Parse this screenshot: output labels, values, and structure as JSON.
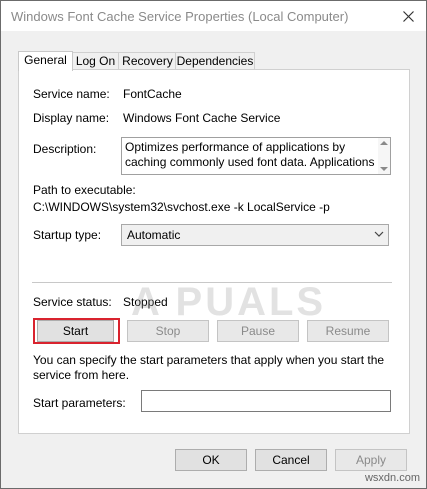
{
  "window": {
    "title": "Windows Font Cache Service Properties (Local Computer)"
  },
  "tabs": [
    {
      "label": "General",
      "active": true
    },
    {
      "label": "Log On"
    },
    {
      "label": "Recovery"
    },
    {
      "label": "Dependencies"
    }
  ],
  "general": {
    "service_name_label": "Service name:",
    "service_name_value": "FontCache",
    "display_name_label": "Display name:",
    "display_name_value": "Windows Font Cache Service",
    "description_label": "Description:",
    "description_value": "Optimizes performance of applications by caching commonly used font data. Applications will start this",
    "path_label": "Path to executable:",
    "path_value": "C:\\WINDOWS\\system32\\svchost.exe -k LocalService -p",
    "startup_type_label": "Startup type:",
    "startup_type_value": "Automatic",
    "service_status_label": "Service status:",
    "service_status_value": "Stopped",
    "buttons": {
      "start": "Start",
      "stop": "Stop",
      "pause": "Pause",
      "resume": "Resume"
    },
    "hint_text": "You can specify the start parameters that apply when you start the service from here.",
    "start_params_label": "Start parameters:",
    "start_params_value": ""
  },
  "footer": {
    "ok": "OK",
    "cancel": "Cancel",
    "apply": "Apply"
  },
  "watermark": {
    "text": "A PUALS",
    "source": "wsxdn.com"
  },
  "colors": {
    "highlight": "#d9232e",
    "disabled_text": "#8a8a8a"
  }
}
